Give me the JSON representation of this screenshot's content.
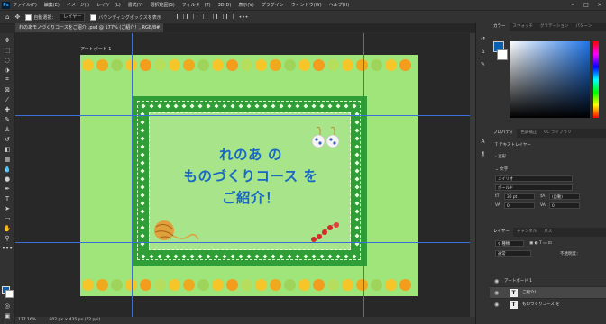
{
  "app": {
    "logo": "Ps"
  },
  "menubar": {
    "items": [
      "ファイル(F)",
      "編集(E)",
      "イメージ(I)",
      "レイヤー(L)",
      "書式(Y)",
      "選択範囲(S)",
      "フィルター(T)",
      "3D(D)",
      "表示(V)",
      "プラグイン",
      "ウィンドウ(W)",
      "ヘルプ(H)"
    ],
    "window_controls": [
      "–",
      "□",
      "×"
    ]
  },
  "options_bar": {
    "auto_select_label": "自動選択：",
    "layer_dropdown": "レイヤー",
    "bounding_box_label": "バウンディングボックスを表示"
  },
  "document": {
    "tab_title": "れのあモノづくりコースをご紹介!.psd @ 177% (ご紹介！, RGB/8#)",
    "artboard_label": "アートボード 1",
    "title_lines": [
      "れのあ の",
      "ものづくりコース を",
      "ご紹介！"
    ],
    "dot_colors": [
      "#f5c52a",
      "#f0a81e",
      "#9fd45a",
      "#f5c52a",
      "#f39c1e",
      "#b7dd5c"
    ],
    "background_color": "#9fe57a",
    "frame_color": "#2f9e36",
    "text_color": "#1868c4"
  },
  "statusbar": {
    "zoom": "177.16%",
    "size": "602 px × 435 px (72 ppi)"
  },
  "color_panel": {
    "tabs": [
      "カラー",
      "スウォッチ",
      "グラデーション",
      "パターン"
    ],
    "foreground": "#0b5fb0",
    "background": "#ffffff"
  },
  "properties_panel": {
    "tabs": [
      "プロパティ",
      "色調補正",
      "CC ライブラリ"
    ],
    "layer_type": "テキストレイヤー",
    "transform_label": "変形",
    "character_label": "文字",
    "font_family": "メイリオ",
    "font_style": "ボールド",
    "font_size": "30 pt",
    "leading": "(自動)",
    "tracking": "0",
    "va_label": "VA",
    "tracking_value": "0"
  },
  "layers_panel": {
    "tabs": [
      "レイヤー",
      "チャンネル",
      "パス"
    ],
    "filter_label": "種類",
    "blend_mode": "通常",
    "opacity_label": "不透明度：",
    "layers": [
      {
        "name": "アートボード 1",
        "type": "artboard"
      },
      {
        "name": "ご紹介！",
        "type": "text"
      },
      {
        "name": "ものづくりコース を",
        "type": "text"
      }
    ]
  }
}
